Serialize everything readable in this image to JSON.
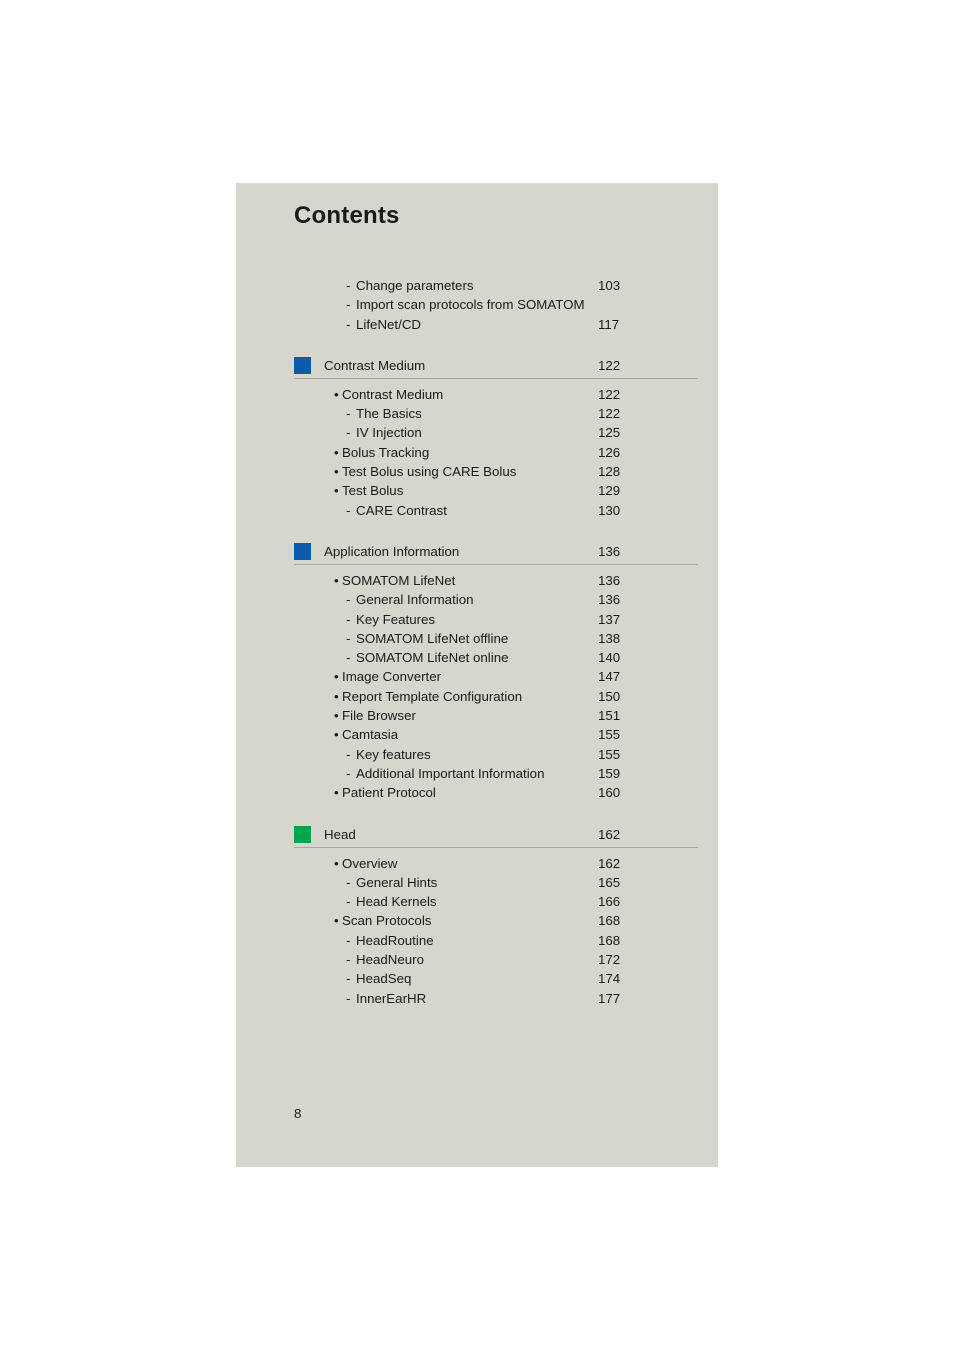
{
  "page": {
    "title": "Contents",
    "page_number": "8"
  },
  "colors": {
    "page_background": "#d6d6cc",
    "blue_marker": "#0a5bab",
    "green_marker": "#00a550",
    "rule": "#a8a89e",
    "text": "#1a1a1a"
  },
  "groups": [
    {
      "header": null,
      "entries": [
        {
          "level": "dash",
          "label": "Change parameters",
          "page": "103"
        },
        {
          "level": "dash",
          "label": "Import scan protocols from SOMATOM LifeNet/CD",
          "page": "117",
          "two_line": true,
          "line1": "Import scan protocols from SOMATOM",
          "line2": "LifeNet/CD"
        }
      ]
    },
    {
      "header": {
        "label": "Contrast Medium",
        "page": "122",
        "marker": "blue"
      },
      "entries": [
        {
          "level": "bullet",
          "label": "Contrast Medium",
          "page": "122"
        },
        {
          "level": "dash",
          "label": "The Basics",
          "page": "122"
        },
        {
          "level": "dash",
          "label": "IV Injection",
          "page": "125"
        },
        {
          "level": "bullet",
          "label": "Bolus Tracking",
          "page": "126"
        },
        {
          "level": "bullet",
          "label": "Test Bolus using CARE Bolus",
          "page": "128"
        },
        {
          "level": "bullet",
          "label": "Test Bolus",
          "page": "129"
        },
        {
          "level": "dash",
          "label": "CARE Contrast",
          "page": "130"
        }
      ]
    },
    {
      "header": {
        "label": "Application Information",
        "page": "136",
        "marker": "blue"
      },
      "entries": [
        {
          "level": "bullet",
          "label": "SOMATOM LifeNet",
          "page": "136"
        },
        {
          "level": "dash",
          "label": "General Information",
          "page": "136"
        },
        {
          "level": "dash",
          "label": "Key Features",
          "page": "137"
        },
        {
          "level": "dash",
          "label": "SOMATOM LifeNet offline",
          "page": "138"
        },
        {
          "level": "dash",
          "label": "SOMATOM LifeNet online",
          "page": "140"
        },
        {
          "level": "bullet",
          "label": "Image Converter",
          "page": "147"
        },
        {
          "level": "bullet",
          "label": "Report Template Configuration",
          "page": "150"
        },
        {
          "level": "bullet",
          "label": "File Browser",
          "page": "151"
        },
        {
          "level": "bullet",
          "label": "Camtasia",
          "page": "155"
        },
        {
          "level": "dash",
          "label": "Key features",
          "page": "155"
        },
        {
          "level": "dash",
          "label": "Additional Important Information",
          "page": "159"
        },
        {
          "level": "bullet",
          "label": "Patient Protocol",
          "page": "160"
        }
      ]
    },
    {
      "header": {
        "label": "Head",
        "page": "162",
        "marker": "green"
      },
      "entries": [
        {
          "level": "bullet",
          "label": "Overview",
          "page": "162"
        },
        {
          "level": "dash",
          "label": "General Hints",
          "page": "165"
        },
        {
          "level": "dash",
          "label": "Head Kernels",
          "page": "166"
        },
        {
          "level": "bullet",
          "label": "Scan Protocols",
          "page": "168"
        },
        {
          "level": "dash",
          "label": "HeadRoutine",
          "page": "168"
        },
        {
          "level": "dash",
          "label": "HeadNeuro",
          "page": "172"
        },
        {
          "level": "dash",
          "label": "HeadSeq",
          "page": "174"
        },
        {
          "level": "dash",
          "label": "InnerEarHR",
          "page": "177"
        }
      ]
    }
  ]
}
